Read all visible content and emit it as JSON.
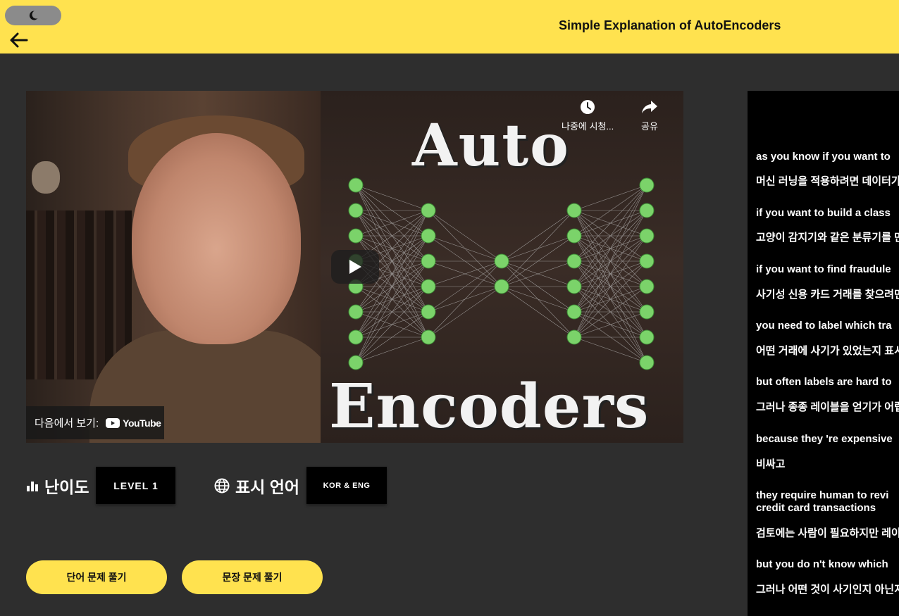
{
  "header": {
    "title": "Simple Explanation of AutoEncoders",
    "color": "#ffe24f"
  },
  "video": {
    "watch_later": "나중에 시청...",
    "share": "공유",
    "watch_on": "다음에서 보기:",
    "youtube": "YouTube",
    "overlay_top": "Auto",
    "overlay_bottom": "Encoders"
  },
  "meta": {
    "difficulty_label": "난이도",
    "difficulty_value": "LEVEL 1",
    "language_label": "표시 언어",
    "language_value": "KOR & ENG"
  },
  "buttons": {
    "word_quiz": "단어 문제 풀기",
    "sentence_quiz": "문장 문제 풀기"
  },
  "subtitles": [
    {
      "en": "as you know if you want to",
      "ko": "머신 러닝을 적용하려면 데이터가"
    },
    {
      "en": "if you want to build a class",
      "ko": "고양이 감지기와 같은 분류기를 만"
    },
    {
      "en": "if you want to find fraudule",
      "ko": "사기성 신용 카드 거래를 찾으려면"
    },
    {
      "en": "you need to label which tra",
      "ko": "어떤 거래에 사기가 있었는지 표시"
    },
    {
      "en": "but often labels are hard to",
      "ko": "그러나 종종 레이블을 얻기가 어렵"
    },
    {
      "en": "because they 're expensive",
      "ko": "비싸고"
    },
    {
      "en": "they require human to revi",
      "en2": "credit card transactions",
      "ko": "검토에는 사람이 필요하지만 레이"
    },
    {
      "en": "but you do n't know which",
      "ko": "그러나 어떤 것이 사기인지 아닌지"
    }
  ]
}
